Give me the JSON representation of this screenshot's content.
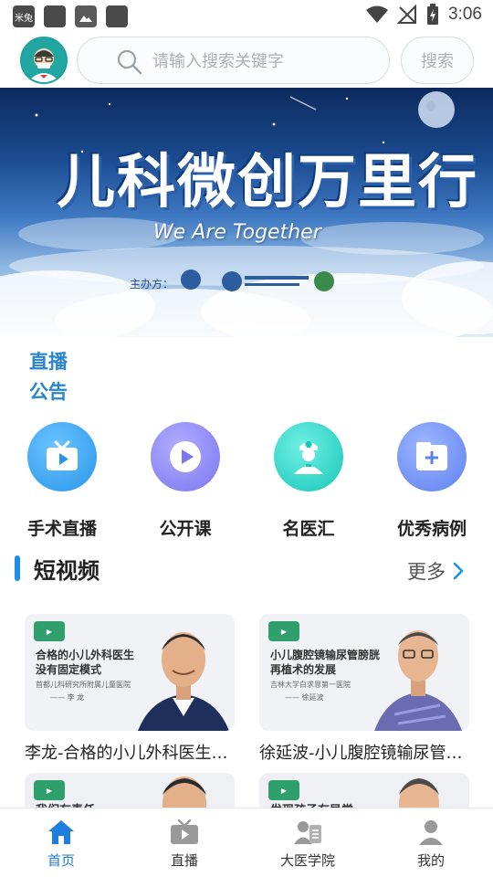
{
  "status_bar": {
    "carrier_badge": "米兔",
    "time": "3:06"
  },
  "search": {
    "placeholder": "请输入搜索关键字",
    "button_label": "搜索"
  },
  "banner": {
    "title": "儿科微创万里行",
    "subtitle": "We Are Together",
    "host_label": "主办方："
  },
  "notices": [
    "直播",
    "公告"
  ],
  "quick_links": [
    {
      "label": "手术直播",
      "icon": "tv-icon",
      "color": "#35a2f0"
    },
    {
      "label": "公开课",
      "icon": "play-icon",
      "color": "#8b88f5"
    },
    {
      "label": "名医汇",
      "icon": "doctor-icon",
      "color": "#2fd0c4"
    },
    {
      "label": "优秀病例",
      "icon": "case-folder-icon",
      "color": "#6b8cf6"
    }
  ],
  "short_video": {
    "title": "短视频",
    "more": "更多",
    "videos": [
      {
        "title": "李龙-合格的小儿外科医生没有固定模式",
        "thumb_line1": "合格的小儿外科医生",
        "thumb_line2": "没有固定模式",
        "thumb_line3": "首都儿科研究所附属儿童医院",
        "thumb_line4": "—— 李 龙"
      },
      {
        "title": "徐延波-小儿腹腔镜输尿管膀胱再植术的发展",
        "thumb_line1": "小儿腹腔镜输尿管膀胱",
        "thumb_line2": "再植术的发展",
        "thumb_line3": "吉林大学白求恩第一医院",
        "thumb_line4": "—— 徐延波"
      }
    ],
    "partial_titles": [
      "我们有责任",
      "发现孩子有异常"
    ]
  },
  "bottom_nav": [
    {
      "label": "首页",
      "icon": "home-icon",
      "active": true
    },
    {
      "label": "直播",
      "icon": "live-tv-icon",
      "active": false
    },
    {
      "label": "大医学院",
      "icon": "academy-icon",
      "active": false
    },
    {
      "label": "我的",
      "icon": "profile-icon",
      "active": false
    }
  ],
  "colors": {
    "accent": "#1e7ee0",
    "notice_text": "#2a85cf",
    "section_bar": "#1e8fe8"
  }
}
